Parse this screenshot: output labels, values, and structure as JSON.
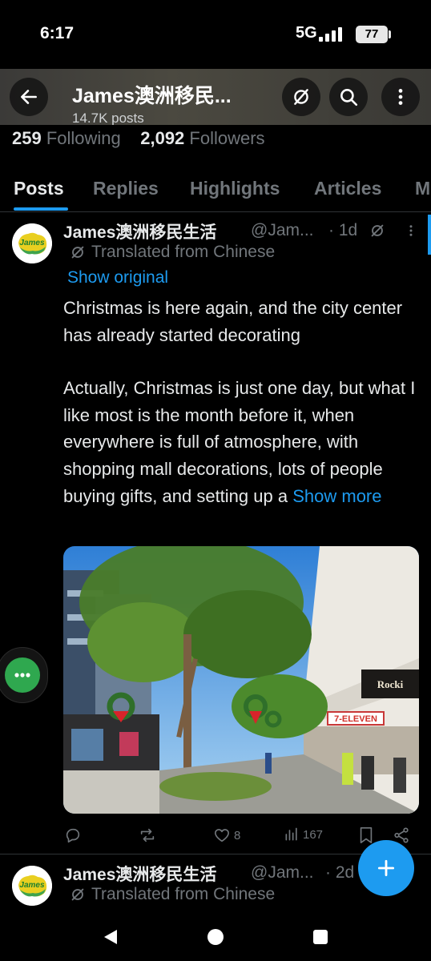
{
  "status_bar": {
    "time": "6:17",
    "network": "5G",
    "battery": "77"
  },
  "header": {
    "name": "James澳洲移民...",
    "posts_count": "14.7K posts",
    "back_icon": "arrow-left-icon",
    "actions": [
      "translate-off-icon",
      "search-icon",
      "more-vertical-icon"
    ]
  },
  "profile": {
    "following_count": "259",
    "following_label": "Following",
    "followers_count": "2,092",
    "followers_label": "Followers"
  },
  "tabs": [
    {
      "label": "Posts",
      "active": true
    },
    {
      "label": "Replies"
    },
    {
      "label": "Highlights"
    },
    {
      "label": "Articles"
    },
    {
      "label": "M"
    }
  ],
  "posts": [
    {
      "avatar_text": "James",
      "name": "James澳洲移民生活",
      "handle": "@Jam...",
      "time": "· 1d",
      "translated_label": "Translated from Chinese",
      "show_original": "Show original",
      "text_para1": "Christmas is here again, and the city center has already started decorating",
      "text_para2": "Actually, Christmas is just one day, but what I like most is the month before it, when everywhere is full of atmosphere, with shopping mall decorations, lots of people buying gifts, and setting up a",
      "show_more": "Show more",
      "photo_signs": {
        "store1": "Rocki",
        "store2": "7-ELEVEN"
      },
      "actions": {
        "replies": "",
        "reposts": "",
        "likes": "8",
        "views": "167"
      }
    },
    {
      "avatar_text": "James",
      "name": "James澳洲移民生活",
      "handle": "@Jam...",
      "time": "· 2d",
      "translated_label": "Translated from Chinese"
    }
  ],
  "colors": {
    "accent": "#1d9bf0",
    "background": "#000000",
    "muted": "#71767b",
    "text": "#e7e9ea",
    "grok": "#2fa84f"
  }
}
